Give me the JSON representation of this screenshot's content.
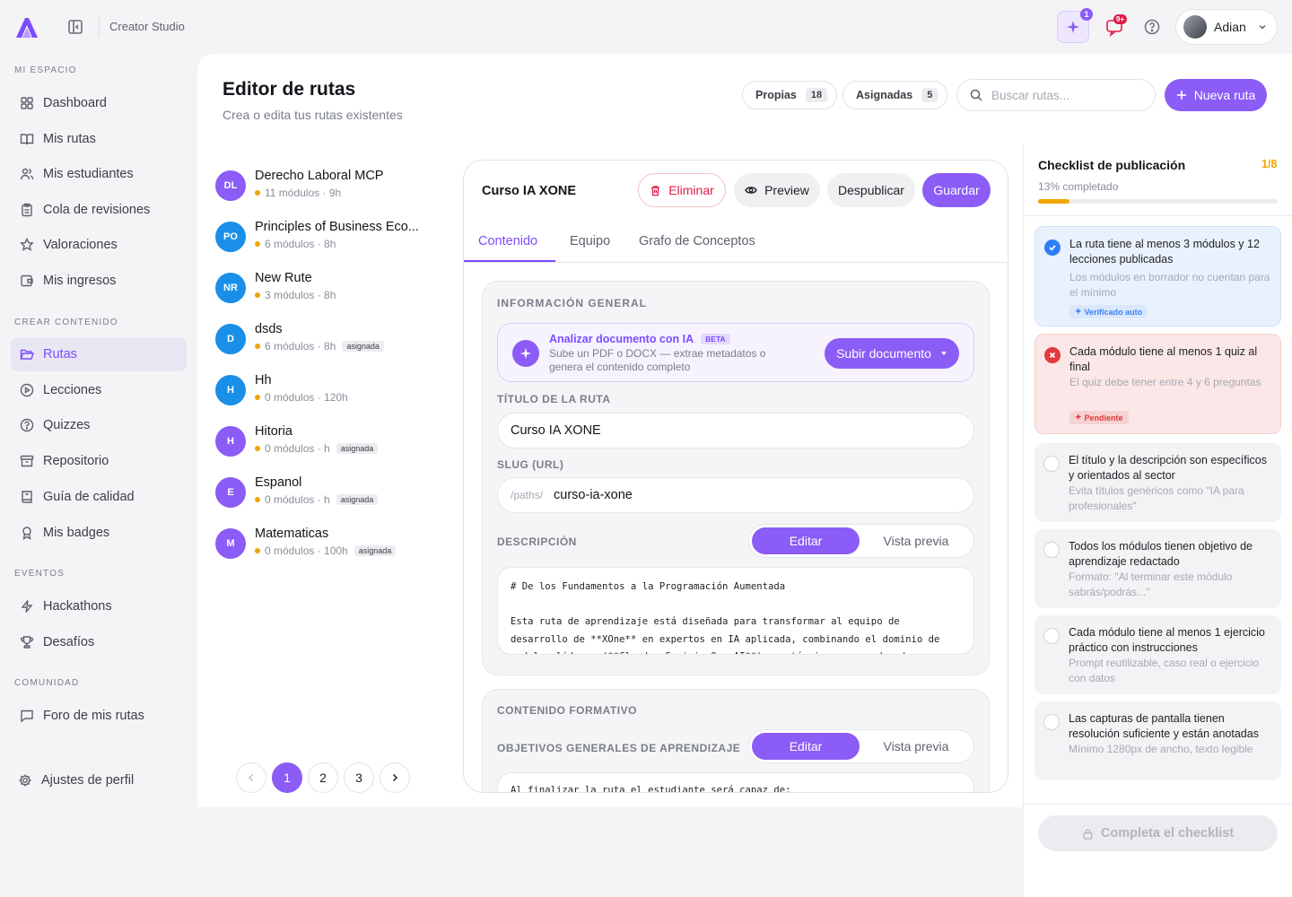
{
  "app": {
    "brand": "Creator Studio",
    "notifications_badge": "9+",
    "ai_badge": "1",
    "user": "Adian"
  },
  "sidebar": {
    "sections": [
      "MI ESPACIO",
      "CREAR CONTENIDO",
      "EVENTOS",
      "COMUNIDAD"
    ],
    "items": [
      {
        "label": "Dashboard",
        "icon": "dashboard-icon"
      },
      {
        "label": "Mis rutas",
        "icon": "book-open-icon"
      },
      {
        "label": "Mis estudiantes",
        "icon": "users-icon"
      },
      {
        "label": "Cola de revisiones",
        "icon": "clipboard-icon"
      },
      {
        "label": "Valoraciones",
        "icon": "star-icon"
      },
      {
        "label": "Mis ingresos",
        "icon": "wallet-icon"
      },
      {
        "label": "Rutas",
        "icon": "folder-open-icon",
        "active": true
      },
      {
        "label": "Lecciones",
        "icon": "play-circle-icon"
      },
      {
        "label": "Quizzes",
        "icon": "help-circle-icon"
      },
      {
        "label": "Repositorio",
        "icon": "archive-icon"
      },
      {
        "label": "Guía de calidad",
        "icon": "book-icon"
      },
      {
        "label": "Mis badges",
        "icon": "award-icon"
      },
      {
        "label": "Hackathons",
        "icon": "zap-icon"
      },
      {
        "label": "Desafíos",
        "icon": "trophy-icon"
      },
      {
        "label": "Foro de mis rutas",
        "icon": "message-square-icon"
      }
    ],
    "settings_label": "Ajustes de perfil"
  },
  "header": {
    "title": "Editor de rutas",
    "subtitle": "Crea o edita tus rutas existentes",
    "filters": [
      {
        "label": "Propias",
        "count": "18"
      },
      {
        "label": "Asignadas",
        "count": "5"
      }
    ],
    "search_placeholder": "Buscar rutas...",
    "new_button": "Nueva ruta"
  },
  "routes": [
    {
      "initials": "DL",
      "title": "Derecho Laboral MCP",
      "meta": "11 módulos · 9h",
      "tag": ""
    },
    {
      "initials": "PO",
      "title": "Principles of Business Eco...",
      "meta": "6 módulos · 8h",
      "tag": ""
    },
    {
      "initials": "NR",
      "title": "New Rute",
      "meta": "3 módulos · 8h",
      "tag": ""
    },
    {
      "initials": "D",
      "title": "dsds",
      "meta": "6 módulos · 8h",
      "tag": "asignada"
    },
    {
      "initials": "H",
      "title": "Hh",
      "meta": "0 módulos · 120h",
      "tag": ""
    },
    {
      "initials": "H",
      "title": "Hitoria",
      "meta": "0 módulos · h",
      "tag": "asignada"
    },
    {
      "initials": "E",
      "title": "Espanol",
      "meta": "0 módulos · h",
      "tag": "asignada"
    },
    {
      "initials": "M",
      "title": "Matematicas",
      "meta": "0 módulos · 100h",
      "tag": "asignada"
    }
  ],
  "pagination": {
    "pages": [
      "1",
      "2",
      "3"
    ],
    "current": "1"
  },
  "editor": {
    "title": "Curso IA XONE",
    "buttons": {
      "delete": "Eliminar",
      "preview": "Preview",
      "unpublish": "Despublicar",
      "save": "Guardar"
    },
    "tabs": [
      "Contenido",
      "Equipo",
      "Grafo de Conceptos"
    ],
    "general": {
      "section_label": "INFORMACIÓN GENERAL",
      "ai_title": "Analizar documento con IA",
      "ai_beta": "BETA",
      "ai_desc": "Sube un PDF o DOCX — extrae metadatos o genera el contenido completo",
      "upload_button": "Subir documento",
      "title_label": "TÍTULO DE LA RUTA",
      "title_value": "Curso IA XONE",
      "slug_label": "SLUG (URL)",
      "slug_prefix": "/paths/",
      "slug_value": "curso-ia-xone",
      "desc_label": "DESCRIPCIÓN",
      "edit_label": "Editar",
      "preview_label": "Vista previa",
      "desc_value": "# De los Fundamentos a la Programación Aumentada\n\nEsta ruta de aprendizaje está diseñada para transformar al equipo de desarrollo de **XOne** en expertos en IA aplicada, combinando el dominio de modelos líderes (**Claude, Gemini, OpenAI**) con técnicas avanzadas de"
    },
    "formative": {
      "section_label": "CONTENIDO FORMATIVO",
      "objectives_label": "OBJETIVOS GENERALES DE APRENDIZAJE",
      "edit_label": "Editar",
      "preview_label": "Vista previa",
      "objectives_value": "Al finalizar la ruta el estudiante será capaz de:"
    }
  },
  "checklist": {
    "title": "Checklist de publicación",
    "count": "1/8",
    "percent_label": "13% completado",
    "progress": 0.13,
    "items": [
      {
        "status": "ok",
        "title": "La ruta tiene al menos 3 módulos y 12 lecciones publicadas",
        "desc": "Los módulos en borrador no cuentan para el mínimo",
        "tag": "Verificado auto"
      },
      {
        "status": "bad",
        "title": "Cada módulo tiene al menos 1 quiz al final",
        "desc": "El quiz debe tener entre 4 y 6 preguntas",
        "tag": "Pendiente"
      },
      {
        "status": "none",
        "title": "El título y la descripción son específicos y orientados al sector",
        "desc": "Evita títulos genéricos como \"IA para profesionales\"",
        "tag": ""
      },
      {
        "status": "none",
        "title": "Todos los módulos tienen objetivo de aprendizaje redactado",
        "desc": "Formato: \"Al terminar este módulo sabrás/podrás...\"",
        "tag": ""
      },
      {
        "status": "none",
        "title": "Cada módulo tiene al menos 1 ejercicio práctico con instrucciones",
        "desc": "Prompt reutilizable, caso real o ejercicio con datos",
        "tag": ""
      },
      {
        "status": "none",
        "title": "Las capturas de pantalla tienen resolución suficiente y están anotadas",
        "desc": "Mínimo 1280px de ancho, texto legible",
        "tag": ""
      }
    ],
    "complete_button": "Completa el checklist"
  },
  "colors": {
    "accent": "#8b5cf6",
    "danger": "#e11d48",
    "warning": "#f0a500",
    "info": "#2f7ef7"
  }
}
